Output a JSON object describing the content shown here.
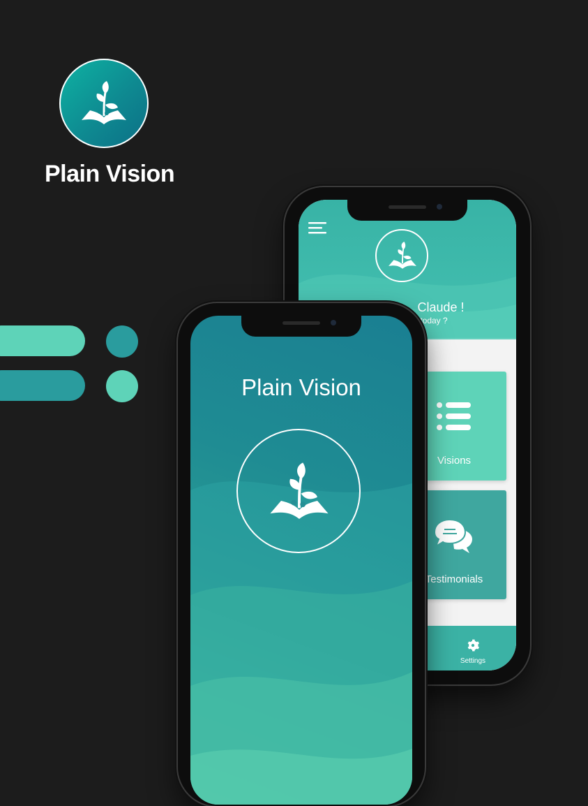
{
  "brand": {
    "name": "Plain Vision",
    "logo_icon": "sprout-book-icon"
  },
  "colors": {
    "background": "#1c1c1c",
    "teal_light": "#5ed3b8",
    "teal_dark": "#2a9c9e",
    "header": "#3bb2a5",
    "white": "#ffffff"
  },
  "back_phone": {
    "menu_icon": "hamburger-menu-icon",
    "greeting": "Claude !",
    "greeting_sub": "today ?",
    "cards": [
      {
        "label": "Visions",
        "icon": "list-icon"
      },
      {
        "label": "Testimonials",
        "icon": "chat-bubbles-icon"
      }
    ],
    "bottom_nav": {
      "settings_label": "Settings",
      "settings_icon": "gear-icon"
    }
  },
  "front_phone": {
    "title": "Plain Vision"
  }
}
